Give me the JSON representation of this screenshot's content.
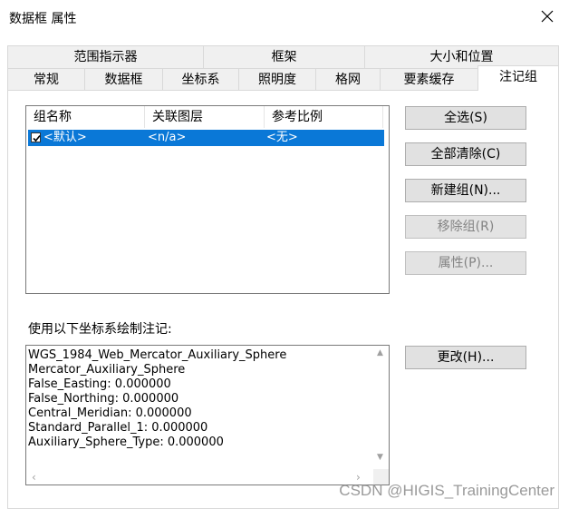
{
  "window": {
    "title": "数据框 属性"
  },
  "tabs_row1": [
    {
      "label": "范围指示器"
    },
    {
      "label": "框架"
    },
    {
      "label": "大小和位置"
    }
  ],
  "tabs_row2": [
    {
      "label": "常规"
    },
    {
      "label": "数据框"
    },
    {
      "label": "坐标系"
    },
    {
      "label": "照明度"
    },
    {
      "label": "格网"
    },
    {
      "label": "要素缓存"
    },
    {
      "label": "注记组",
      "active": true
    }
  ],
  "groups_list": {
    "columns": [
      "组名称",
      "关联图层",
      "参考比例"
    ],
    "rows": [
      {
        "checked": true,
        "name": "<默认>",
        "layer": "<n/a>",
        "scale": "<无>"
      }
    ]
  },
  "buttons": {
    "select_all": "全选(S)",
    "clear_all": "全部清除(C)",
    "new_group": "新建组(N)...",
    "remove_group": "移除组(R)",
    "properties": "属性(P)...",
    "change": "更改(H)..."
  },
  "coord": {
    "label": "使用以下坐标系绘制注记:",
    "lines": [
      "WGS_1984_Web_Mercator_Auxiliary_Sphere",
      "Mercator_Auxiliary_Sphere",
      "False_Easting: 0.000000",
      "False_Northing: 0.000000",
      "Central_Meridian: 0.000000",
      "Standard_Parallel_1: 0.000000",
      "Auxiliary_Sphere_Type: 0.000000"
    ]
  },
  "watermark": "CSDN @HIGIS_TrainingCenter"
}
